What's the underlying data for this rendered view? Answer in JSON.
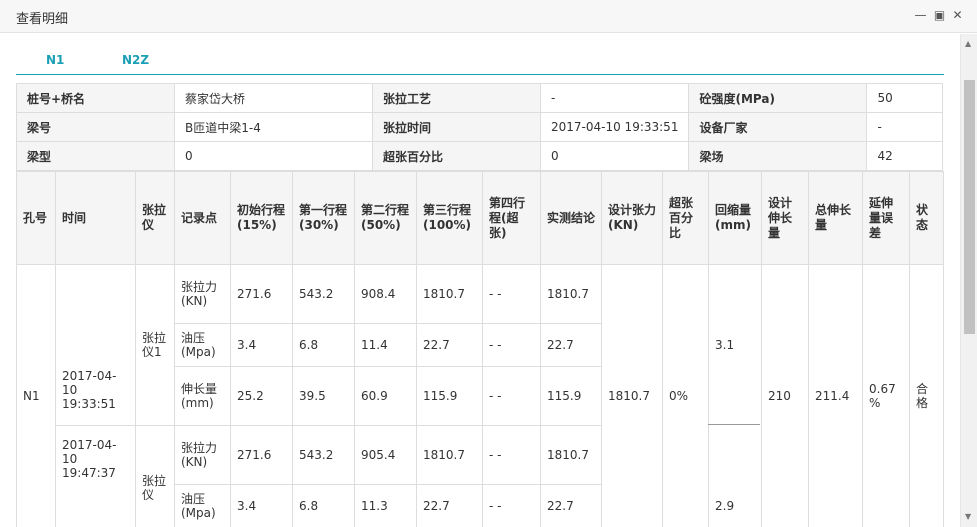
{
  "window": {
    "title": "查看明细"
  },
  "tabs": [
    {
      "label": "N1"
    },
    {
      "label": "N2Z"
    }
  ],
  "info": {
    "pile_bridge": {
      "label": "桩号+桥名",
      "value": "蔡家岱大桥"
    },
    "process": {
      "label": "张拉工艺",
      "value": "-"
    },
    "concrete_strength": {
      "label": "砼强度(MPa)",
      "value": "50"
    },
    "beam_no": {
      "label": "梁号",
      "value": "B匝道中梁1-4"
    },
    "tension_time": {
      "label": "张拉时间",
      "value": "2017-04-10 19:33:51"
    },
    "manufacturer": {
      "label": "设备厂家",
      "value": "-"
    },
    "beam_type": {
      "label": "梁型",
      "value": "0"
    },
    "over_pct": {
      "label": "超张百分比",
      "value": "0"
    },
    "yard": {
      "label": "梁场",
      "value": "42"
    }
  },
  "table": {
    "headers": {
      "hole": "孔号",
      "time": "时间",
      "jack": "张拉仪",
      "record": "记录点",
      "initial": "初始行程(15%)",
      "first": "第一行程(30%)",
      "second": "第二行程(50%)",
      "third": "第三行程(100%)",
      "fourth": "第四行程(超张)",
      "result": "实测结论",
      "design_force": "设计张力(KN)",
      "over_pct": "超张百分比",
      "retract": "回缩量(mm)",
      "design_elong": "设计伸长量",
      "total_elong": "总伸长量",
      "elong_error": "延伸量误差",
      "status": "状态"
    },
    "hole": "N1",
    "design_force": "1810.7",
    "over_pct": "0%",
    "retract_1": "3.1",
    "retract_2": "2.9",
    "design_elong": "210",
    "total_elong": "211.4",
    "elong_error": "0.67 %",
    "status": "合格",
    "group1": {
      "time": "2017-04-10 19:33:51",
      "jack": "张拉仪1",
      "rows": [
        {
          "point": "张拉力(KN)",
          "initial": "271.6",
          "first": "543.2",
          "second": "908.4",
          "third": "1810.7",
          "fourth": "- -",
          "result": "1810.7"
        },
        {
          "point": "油压(Mpa)",
          "initial": "3.4",
          "first": "6.8",
          "second": "11.4",
          "third": "22.7",
          "fourth": "- -",
          "result": "22.7"
        },
        {
          "point": "伸长量(mm)",
          "initial": "25.2",
          "first": "39.5",
          "second": "60.9",
          "third": "115.9",
          "fourth": "- -",
          "result": "115.9"
        }
      ]
    },
    "group2": {
      "time": "2017-04-10 19:47:37",
      "jack": "张拉仪",
      "rows": [
        {
          "point": "张拉力(KN)",
          "initial": "271.6",
          "first": "543.2",
          "second": "905.4",
          "third": "1810.7",
          "fourth": "- -",
          "result": "1810.7"
        },
        {
          "point": "油压(Mpa)",
          "initial": "3.4",
          "first": "6.8",
          "second": "11.3",
          "third": "22.7",
          "fourth": "- -",
          "result": "22.7"
        }
      ]
    }
  }
}
